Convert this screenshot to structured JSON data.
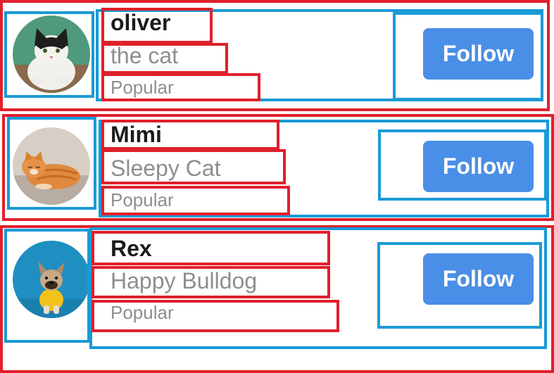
{
  "users": [
    {
      "name": "oliver",
      "subtitle": "the cat",
      "tag": "Popular",
      "follow_label": "Follow"
    },
    {
      "name": "Mimi",
      "subtitle": "Sleepy Cat",
      "tag": "Popular",
      "follow_label": "Follow"
    },
    {
      "name": "Rex",
      "subtitle": "Happy Bulldog",
      "tag": "Popular",
      "follow_label": "Follow"
    }
  ],
  "colors": {
    "button": "#4a8fe7",
    "annotation_red": "#e0202c",
    "annotation_blue": "#1a9ad6"
  }
}
